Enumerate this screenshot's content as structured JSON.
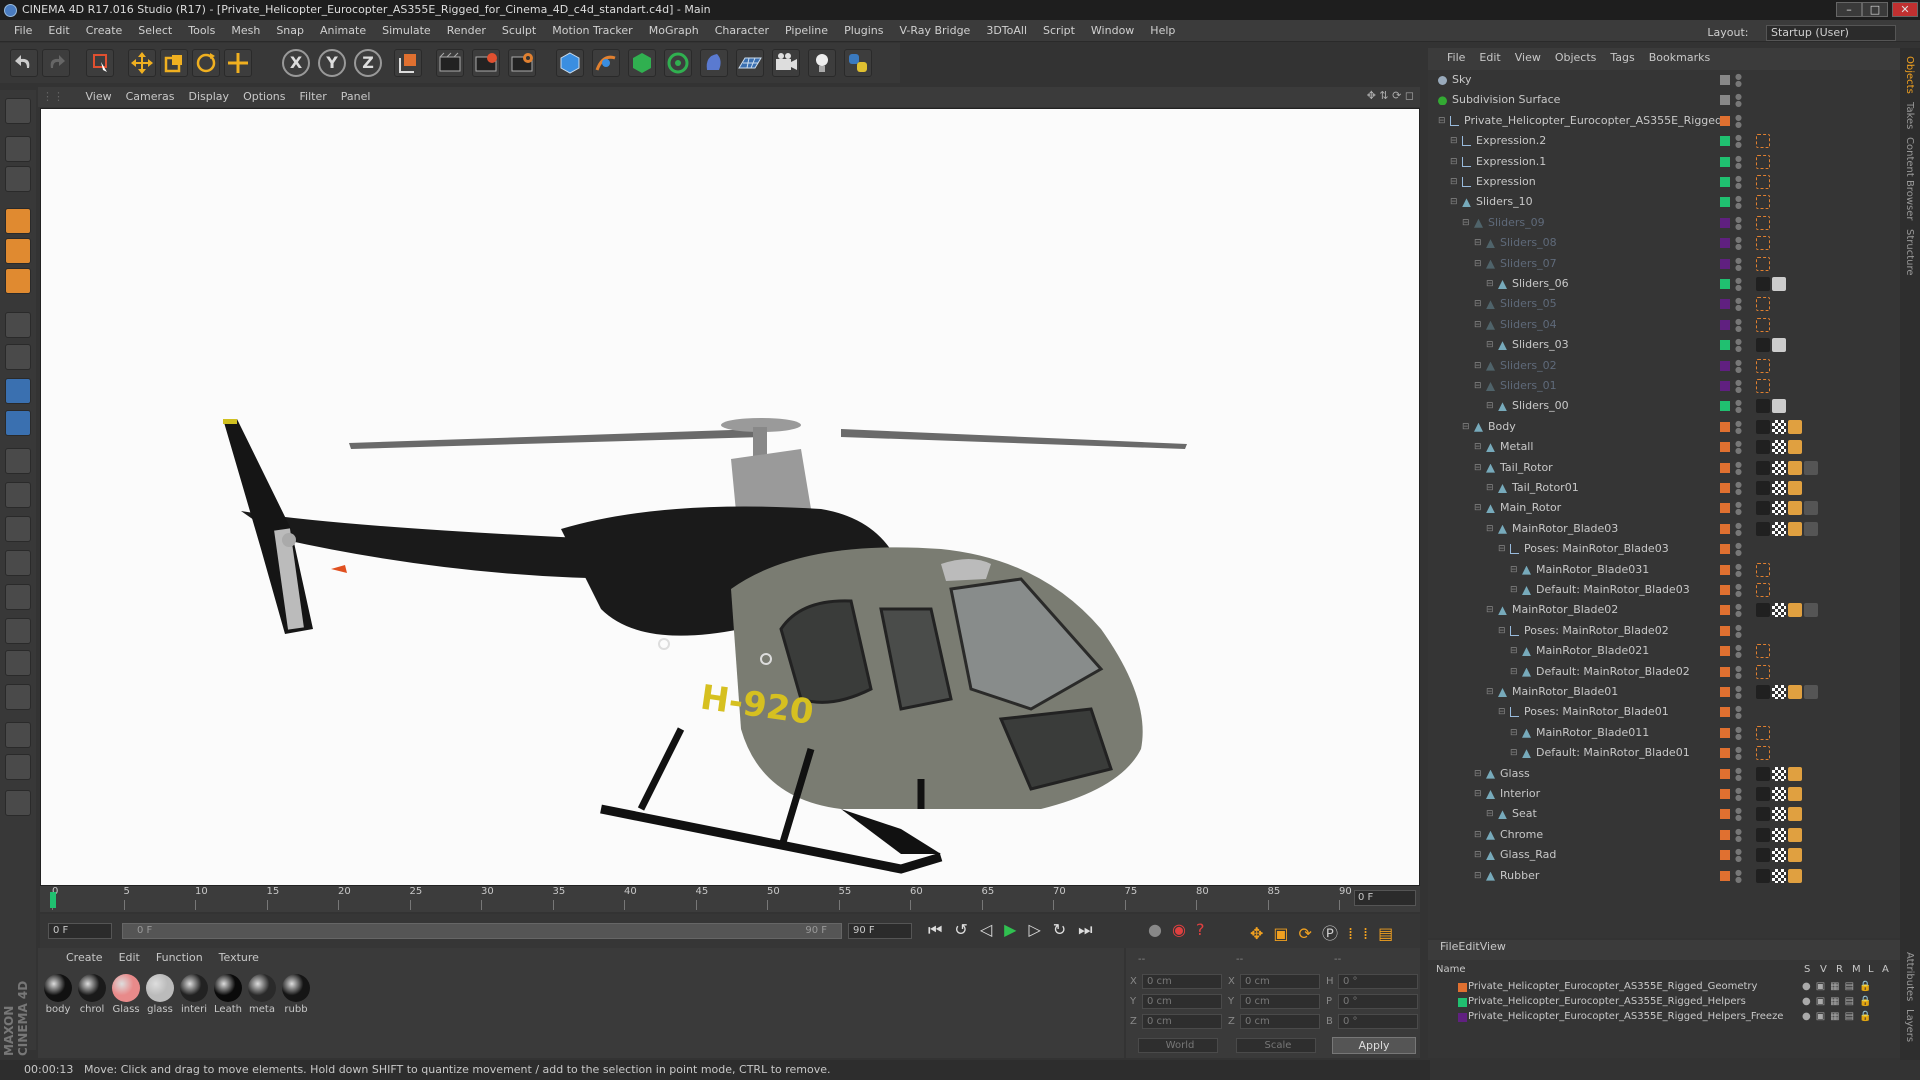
{
  "window": {
    "title": "CINEMA 4D R17.016 Studio (R17) - [Private_Helicopter_Eurocopter_AS355E_Rigged_for_Cinema_4D_c4d_standart.c4d] - Main"
  },
  "menu": [
    "File",
    "Edit",
    "Create",
    "Select",
    "Tools",
    "Mesh",
    "Snap",
    "Animate",
    "Simulate",
    "Render",
    "Sculpt",
    "Motion Tracker",
    "MoGraph",
    "Character",
    "Pipeline",
    "Plugins",
    "V-Ray Bridge",
    "3DToAll",
    "Script",
    "Window",
    "Help"
  ],
  "layout": {
    "label": "Layout:",
    "value": "Startup (User)"
  },
  "toolbar": {
    "axis_x": "X",
    "axis_y": "Y",
    "axis_z": "Z"
  },
  "viewport": {
    "menu": [
      "View",
      "Cameras",
      "Display",
      "Options",
      "Filter",
      "Panel"
    ],
    "registration": "H-920"
  },
  "timeline": {
    "ticks": [
      "0",
      "5",
      "10",
      "15",
      "20",
      "25",
      "30",
      "35",
      "40",
      "45",
      "50",
      "55",
      "60",
      "65",
      "70",
      "75",
      "80",
      "85",
      "90"
    ],
    "current_frame": "0 F",
    "start_field": "0 F",
    "range_start": "0 F",
    "range_end": "90 F",
    "end_field": "90 F"
  },
  "materials": {
    "menu": [
      "Create",
      "Edit",
      "Function",
      "Texture"
    ],
    "items": [
      {
        "label": "body",
        "color": "#111111"
      },
      {
        "label": "chrol",
        "color": "#1a1a1a"
      },
      {
        "label": "Glass",
        "color": "#e88a8a"
      },
      {
        "label": "glass",
        "color": "#bbbbbb"
      },
      {
        "label": "interi",
        "color": "#222222"
      },
      {
        "label": "Leath",
        "color": "#0a0a0a"
      },
      {
        "label": "meta",
        "color": "#2a2a2a"
      },
      {
        "label": "rubb",
        "color": "#151515"
      }
    ]
  },
  "coords": {
    "header_a": "--",
    "header_b": "--",
    "header_c": "--",
    "rows": [
      {
        "a": "X",
        "av": "0 cm",
        "b": "X",
        "bv": "0 cm",
        "c": "H",
        "cv": "0 °"
      },
      {
        "a": "Y",
        "av": "0 cm",
        "b": "Y",
        "bv": "0 cm",
        "c": "P",
        "cv": "0 °"
      },
      {
        "a": "Z",
        "av": "0 cm",
        "b": "Z",
        "bv": "0 cm",
        "c": "B",
        "cv": "0 °"
      }
    ],
    "world": "World",
    "scale": "Scale",
    "apply": "Apply"
  },
  "status": {
    "time": "00:00:13",
    "message": "Move: Click and drag to move elements. Hold down SHIFT to quantize movement / add to the selection in point mode, CTRL to remove."
  },
  "objects": {
    "menu": [
      "File",
      "Edit",
      "View",
      "Objects",
      "Tags",
      "Bookmarks"
    ],
    "rows": [
      {
        "name": "Sky",
        "depth": 0,
        "kind": "sky",
        "color": "#888888",
        "tags": 0
      },
      {
        "name": "Subdivision Surface",
        "depth": 0,
        "kind": "sub",
        "color": "#888888",
        "tags": 0
      },
      {
        "name": "Private_Helicopter_Eurocopter_AS355E_Rigged",
        "depth": 1,
        "kind": "null",
        "color": "#e07030",
        "tags": 0
      },
      {
        "name": "Expression.2",
        "depth": 2,
        "kind": "null",
        "color": "#20c070",
        "tags": 1
      },
      {
        "name": "Expression.1",
        "depth": 2,
        "kind": "null",
        "color": "#20c070",
        "tags": 1
      },
      {
        "name": "Expression",
        "depth": 2,
        "kind": "null",
        "color": "#20c070",
        "tags": 1
      },
      {
        "name": "Sliders_10",
        "depth": 2,
        "kind": "joint",
        "color": "#20c070",
        "tags": 1
      },
      {
        "name": "Sliders_09",
        "depth": 3,
        "kind": "joint",
        "color": "#602080",
        "tags": 1,
        "dim": true
      },
      {
        "name": "Sliders_08",
        "depth": 4,
        "kind": "joint",
        "color": "#602080",
        "tags": 1,
        "dim": true
      },
      {
        "name": "Sliders_07",
        "depth": 4,
        "kind": "joint",
        "color": "#602080",
        "tags": 1,
        "dim": true
      },
      {
        "name": "Sliders_06",
        "depth": 5,
        "kind": "joint",
        "color": "#20c070",
        "tags": 2
      },
      {
        "name": "Sliders_05",
        "depth": 4,
        "kind": "joint",
        "color": "#602080",
        "tags": 1,
        "dim": true
      },
      {
        "name": "Sliders_04",
        "depth": 4,
        "kind": "joint",
        "color": "#602080",
        "tags": 1,
        "dim": true
      },
      {
        "name": "Sliders_03",
        "depth": 5,
        "kind": "joint",
        "color": "#20c070",
        "tags": 2
      },
      {
        "name": "Sliders_02",
        "depth": 4,
        "kind": "joint",
        "color": "#602080",
        "tags": 1,
        "dim": true
      },
      {
        "name": "Sliders_01",
        "depth": 4,
        "kind": "joint",
        "color": "#602080",
        "tags": 1,
        "dim": true
      },
      {
        "name": "Sliders_00",
        "depth": 5,
        "kind": "joint",
        "color": "#20c070",
        "tags": 2
      },
      {
        "name": "Body",
        "depth": 3,
        "kind": "joint",
        "color": "#e07030",
        "tags": 3
      },
      {
        "name": "Metall",
        "depth": 4,
        "kind": "joint",
        "color": "#e07030",
        "tags": 3
      },
      {
        "name": "Tail_Rotor",
        "depth": 4,
        "kind": "joint",
        "color": "#e07030",
        "tags": 4
      },
      {
        "name": "Tail_Rotor01",
        "depth": 5,
        "kind": "joint",
        "color": "#e07030",
        "tags": 3
      },
      {
        "name": "Main_Rotor",
        "depth": 4,
        "kind": "joint",
        "color": "#e07030",
        "tags": 4
      },
      {
        "name": "MainRotor_Blade03",
        "depth": 5,
        "kind": "joint",
        "color": "#e07030",
        "tags": 4
      },
      {
        "name": "Poses: MainRotor_Blade03",
        "depth": 6,
        "kind": "null",
        "color": "#e07030",
        "tags": 0
      },
      {
        "name": "MainRotor_Blade031",
        "depth": 7,
        "kind": "joint",
        "color": "#e07030",
        "tags": 1
      },
      {
        "name": "Default: MainRotor_Blade03",
        "depth": 7,
        "kind": "joint",
        "color": "#e07030",
        "tags": 1
      },
      {
        "name": "MainRotor_Blade02",
        "depth": 5,
        "kind": "joint",
        "color": "#e07030",
        "tags": 4
      },
      {
        "name": "Poses: MainRotor_Blade02",
        "depth": 6,
        "kind": "null",
        "color": "#e07030",
        "tags": 0
      },
      {
        "name": "MainRotor_Blade021",
        "depth": 7,
        "kind": "joint",
        "color": "#e07030",
        "tags": 1
      },
      {
        "name": "Default: MainRotor_Blade02",
        "depth": 7,
        "kind": "joint",
        "color": "#e07030",
        "tags": 1
      },
      {
        "name": "MainRotor_Blade01",
        "depth": 5,
        "kind": "joint",
        "color": "#e07030",
        "tags": 4
      },
      {
        "name": "Poses: MainRotor_Blade01",
        "depth": 6,
        "kind": "null",
        "color": "#e07030",
        "tags": 0
      },
      {
        "name": "MainRotor_Blade011",
        "depth": 7,
        "kind": "joint",
        "color": "#e07030",
        "tags": 1
      },
      {
        "name": "Default: MainRotor_Blade01",
        "depth": 7,
        "kind": "joint",
        "color": "#e07030",
        "tags": 1
      },
      {
        "name": "Glass",
        "depth": 4,
        "kind": "joint",
        "color": "#e07030",
        "tags": 3
      },
      {
        "name": "Interior",
        "depth": 4,
        "kind": "joint",
        "color": "#e07030",
        "tags": 3
      },
      {
        "name": "Seat",
        "depth": 5,
        "kind": "joint",
        "color": "#e07030",
        "tags": 3
      },
      {
        "name": "Chrome",
        "depth": 4,
        "kind": "joint",
        "color": "#e07030",
        "tags": 3
      },
      {
        "name": "Glass_Rad",
        "depth": 4,
        "kind": "joint",
        "color": "#e07030",
        "tags": 3
      },
      {
        "name": "Rubber",
        "depth": 4,
        "kind": "joint",
        "color": "#e07030",
        "tags": 3
      }
    ]
  },
  "layers": {
    "menu": [
      "File",
      "Edit",
      "View"
    ],
    "header": {
      "name": "Name",
      "s": "S",
      "v": "V",
      "r": "R",
      "m": "M",
      "l": "L",
      "a": "A"
    },
    "rows": [
      {
        "name": "Private_Helicopter_Eurocopter_AS355E_Rigged_Geometry",
        "color": "#e07030"
      },
      {
        "name": "Private_Helicopter_Eurocopter_AS355E_Rigged_Helpers",
        "color": "#20c070"
      },
      {
        "name": "Private_Helicopter_Eurocopter_AS355E_Rigged_Helpers_Freeze",
        "color": "#602080"
      }
    ]
  },
  "side_tabs": [
    "Objects",
    "Takes",
    "Content Browser",
    "Structure"
  ],
  "side_tabs_bottom": [
    "Attributes",
    "Layers"
  ],
  "brand": "MAXON CINEMA 4D"
}
